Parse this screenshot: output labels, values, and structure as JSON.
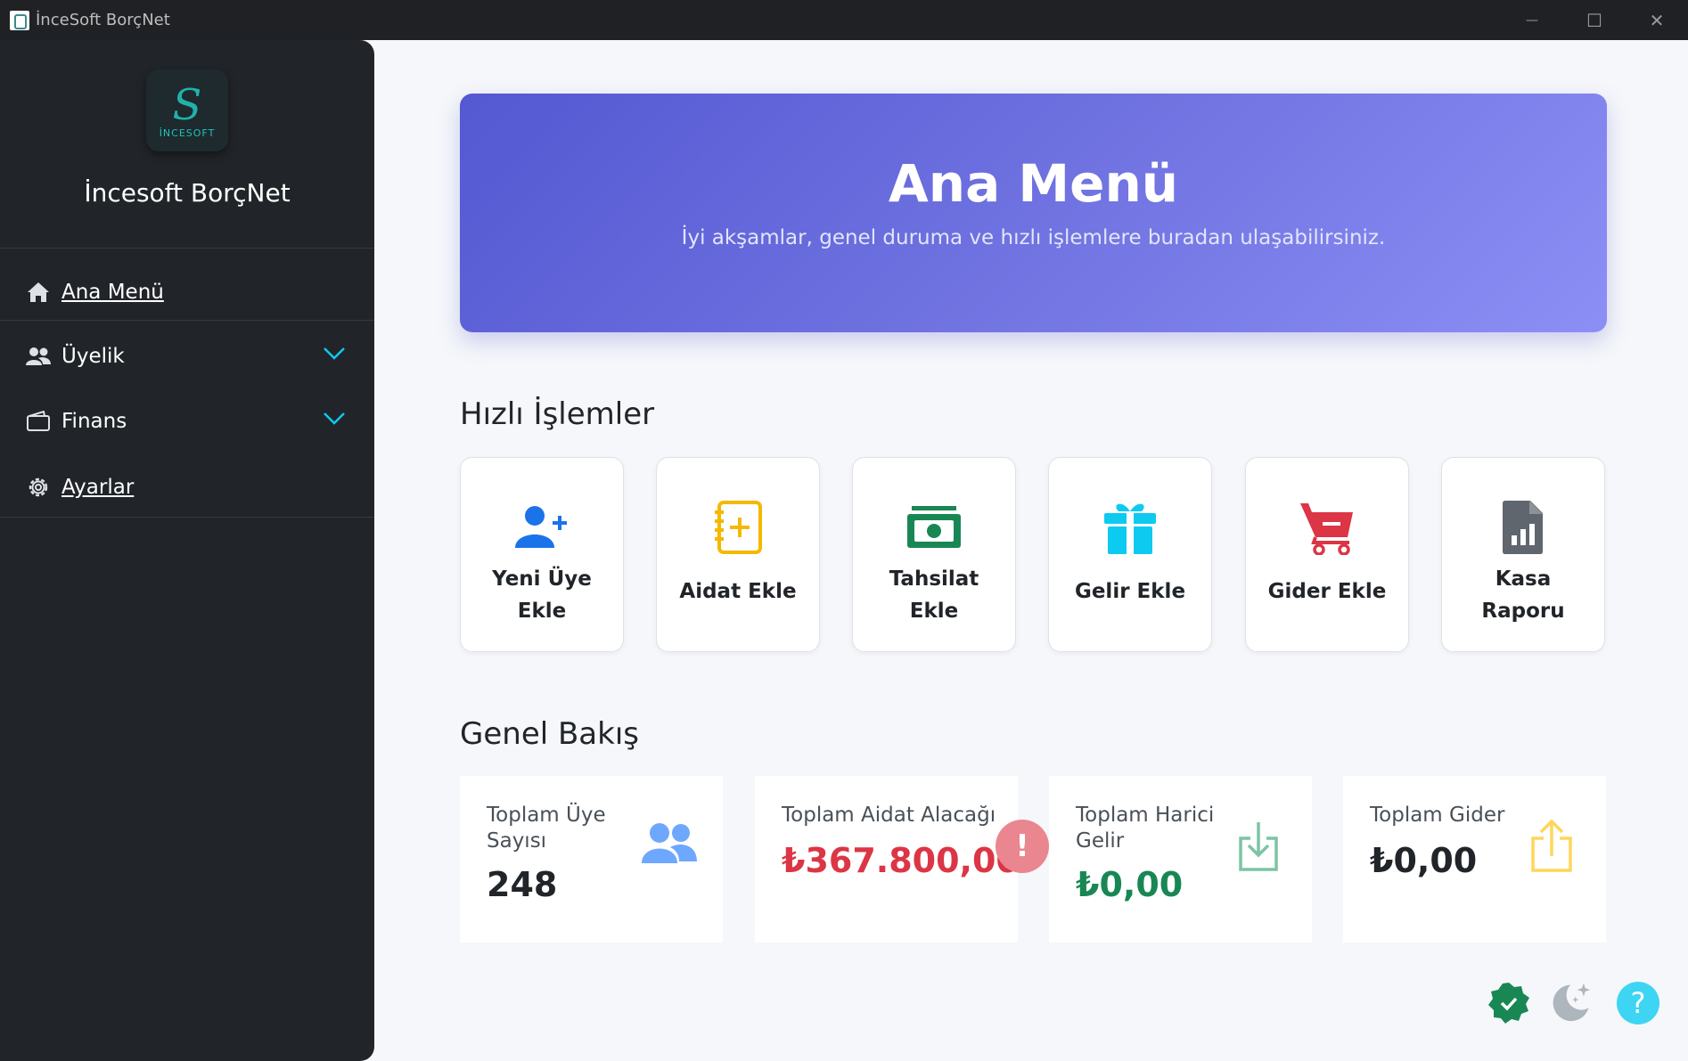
{
  "window": {
    "title": "İnceSoft BorçNet",
    "controls": {
      "minimize": "—",
      "maximize": "☐",
      "close": "✕"
    }
  },
  "sidebar": {
    "logo_text": "İNCESOFT",
    "logo_letter": "S",
    "brand": "İncesoft BorçNet",
    "items": [
      {
        "label": "Ana Menü",
        "icon": "home-icon"
      },
      {
        "label": "Üyelik",
        "icon": "users-icon"
      },
      {
        "label": "Finans",
        "icon": "wallet-icon"
      },
      {
        "label": "Ayarlar",
        "icon": "gear-icon"
      }
    ]
  },
  "hero": {
    "title": "Ana Menü",
    "subtitle": "İyi akşamlar, genel duruma ve hızlı işlemlere buradan ulaşabilirsiniz."
  },
  "quick": {
    "title": "Hızlı İşlemler",
    "items": [
      {
        "label": "Yeni Üye Ekle",
        "icon": "user-plus-icon",
        "color": "#1a73e8"
      },
      {
        "label": "Aidat Ekle",
        "icon": "notebook-plus-icon",
        "color": "#f5b800"
      },
      {
        "label": "Tahsilat Ekle",
        "icon": "cash-icon",
        "color": "#198754"
      },
      {
        "label": "Gelir Ekle",
        "icon": "gift-icon",
        "color": "#0dcaf0"
      },
      {
        "label": "Gider Ekle",
        "icon": "cart-minus-icon",
        "color": "#dc3545"
      },
      {
        "label": "Kasa Raporu",
        "icon": "report-icon",
        "color": "#6c757d"
      }
    ]
  },
  "overview": {
    "title": "Genel Bakış",
    "stats": [
      {
        "title": "Toplam Üye Sayısı",
        "value": "248",
        "color": "#212529"
      },
      {
        "title": "Toplam Aidat Alacağı",
        "value": "₺367.800,00",
        "color": "#dc3545"
      },
      {
        "title": "Toplam Harici Gelir",
        "value": "₺0,00",
        "color": "#198754"
      },
      {
        "title": "Toplam Gider",
        "value": "₺0,00",
        "color": "#212529"
      }
    ],
    "alert_mark": "!"
  },
  "fabs": {
    "help": "?"
  }
}
